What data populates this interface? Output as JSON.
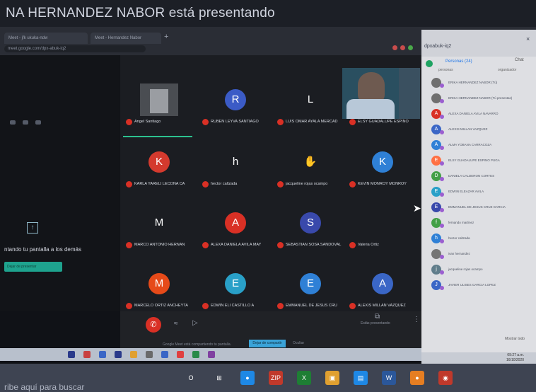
{
  "banner": {
    "text": "NA HERNANDEZ NABOR está presentando"
  },
  "browser": {
    "tabs": [
      "Meet - jfk ukuka-ndw",
      "Meet - Hernandez Nabor"
    ],
    "url": "meet.google.com/dpx-abuk-iq2"
  },
  "share": {
    "text": "ntando tu pantalla a los demás",
    "button_label": "Dejar de presentar"
  },
  "tiles": [
    {
      "name": "Angel Santiago",
      "letter": "",
      "color": "#3c3f46",
      "kind": "camera"
    },
    {
      "name": "RUBEN LEYVA SANTIAGO",
      "letter": "R",
      "color": "#3b5bc6"
    },
    {
      "name": "LUIS OMAR AYALA MERCAD",
      "letter": "L",
      "color": "transparent"
    },
    {
      "name": "ELSY GUADALUPE ESPINO",
      "letter": "",
      "color": "#2a4f60",
      "kind": "presenter"
    },
    {
      "name": "KARLA YARELI LECONA CA",
      "letter": "K",
      "color": "#d43a2e"
    },
    {
      "name": "hector caltzada",
      "letter": "h",
      "color": "transparent"
    },
    {
      "name": "jacqueline rojas ocampo",
      "letter": "",
      "color": "transparent",
      "kind": "hand"
    },
    {
      "name": "KEVIN MONROY MONROY",
      "letter": "K",
      "color": "#2f80d6"
    },
    {
      "name": "MARCO ANTONIO HERNAN",
      "letter": "M",
      "color": "transparent"
    },
    {
      "name": "ALEXA DANIELA AVILA MAY",
      "letter": "A",
      "color": "#d93025"
    },
    {
      "name": "SEBASTIAN SOSA SANDOVAL",
      "letter": "S",
      "color": "#3949ab"
    },
    {
      "name": "Valeria Ortiz",
      "letter": "",
      "color": "transparent"
    },
    {
      "name": "MARCELO ORTIZ ANCHEYTA",
      "letter": "M",
      "color": "#e64a19"
    },
    {
      "name": "EDWIN ELI CASTILLO A",
      "letter": "E",
      "color": "#29a0c8"
    },
    {
      "name": "EMMANUEL DE JESUS CRU",
      "letter": "E",
      "color": "#2f80d6"
    },
    {
      "name": "ALEXIS MILLAN VAZQUEZ",
      "letter": "A",
      "color": "#3a66c6"
    }
  ],
  "controls": {
    "present_label": "Estás presentando",
    "notice": "Google Meet está compartiendo tu pantalla.",
    "stop_label": "Dejar de compartir",
    "hide_label": "Ocultar"
  },
  "panel": {
    "code": "dpxabuk-iq2",
    "close": "×",
    "people_tab": "Personas (24)",
    "chat_tab": "Chat",
    "sub1": "personas",
    "sub2": "organizador",
    "more": "Mostrar todo",
    "people": [
      {
        "name": "ERIKA HERNANDEZ NABOR (Tú)",
        "initial": "",
        "color": "#6f6f6f"
      },
      {
        "name": "ERIKA HERNANDEZ NABOR (Tú presentas)",
        "initial": "",
        "color": "#6f6f6f"
      },
      {
        "name": "ALEXA DANIELA AVILA NAVARRO",
        "initial": "A",
        "color": "#d93025"
      },
      {
        "name": "ALEXIS MILLAN VAZQUEZ",
        "initial": "A",
        "color": "#3a66c6"
      },
      {
        "name": "ALMA YOBANA CARRACOZA",
        "initial": "A",
        "color": "#2f80d6"
      },
      {
        "name": "ELSY GUADALUPE ESPINO PUGA",
        "initial": "E",
        "color": "#ff7043"
      },
      {
        "name": "DANIELA CALDERON CORTES",
        "initial": "D",
        "color": "#43a047"
      },
      {
        "name": "EDWIN ELEAZAR AVILA",
        "initial": "E",
        "color": "#29a0c8"
      },
      {
        "name": "EMMANUEL DE JESUS CRUZ GARCIA",
        "initial": "E",
        "color": "#3949ab"
      },
      {
        "name": "fernando martinez",
        "initial": "f",
        "color": "#43a047"
      },
      {
        "name": "hector caltzada",
        "initial": "h",
        "color": "#2f80d6"
      },
      {
        "name": "ivan hernandez",
        "initial": "",
        "color": "#757575"
      },
      {
        "name": "jacqueline rojas ocampo",
        "initial": "j",
        "color": "#607d8b"
      },
      {
        "name": "JAVIER ULISES GARCIA LOPEZ",
        "initial": "J",
        "color": "#3a66c6"
      }
    ]
  },
  "taskbar": {
    "search": "ribe aquí para buscar",
    "time": "09:27 a.m.",
    "date": "16/10/2020",
    "apps": [
      "O",
      "⊞",
      "●",
      "ZIP",
      "X",
      "▣",
      "▤",
      "W",
      "●",
      "◉"
    ]
  }
}
